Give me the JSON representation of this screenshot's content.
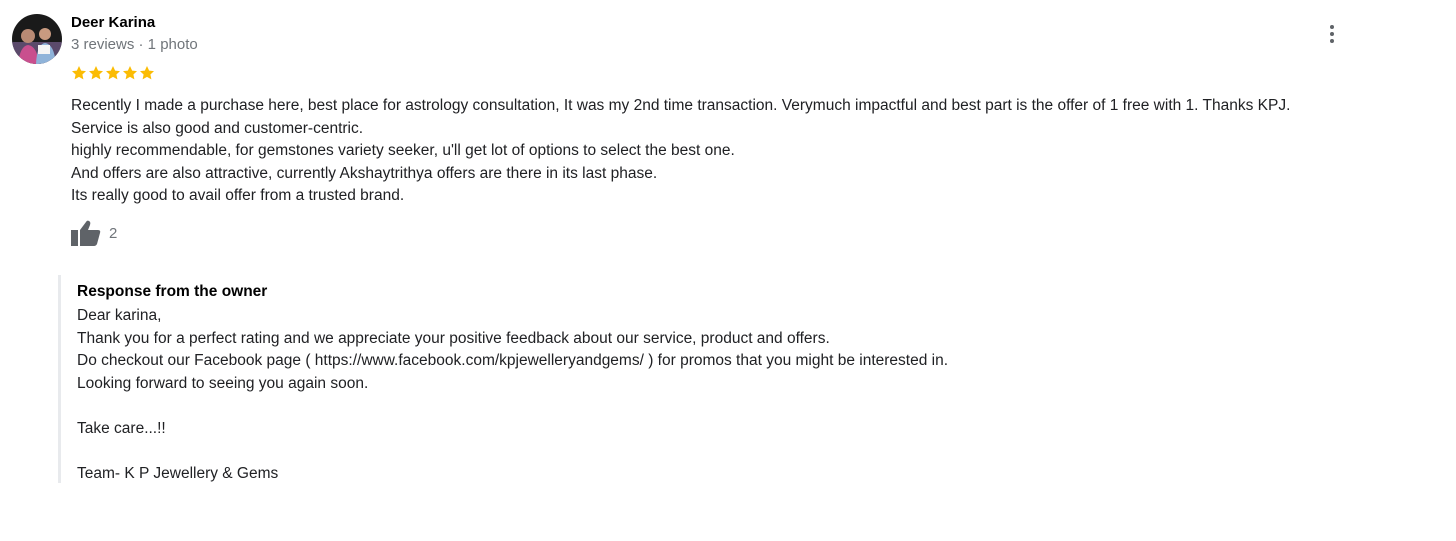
{
  "review": {
    "reviewer_name": "Deer Karina",
    "reviewer_meta": "3 reviews · 1 photo",
    "rating": 5,
    "rating_color": "#fbbc04",
    "text_lines": [
      "Recently I made a purchase here, best place for astrology consultation, It was my 2nd time transaction. Verymuch impactful and best part is the offer of 1 free with 1. Thanks KPJ.",
      "Service is also good and customer-centric.",
      "highly recommendable, for gemstones variety seeker, u'll get lot of options to select the best one.",
      "And offers are also attractive, currently Akshaytrithya offers are there in its last phase.",
      "Its really good to avail offer from a trusted brand."
    ],
    "like_count": "2",
    "icons": {
      "avatar": "avatar-photo",
      "more": "more-vert-icon",
      "star": "star-icon",
      "like": "thumbs-up-icon"
    }
  },
  "owner_response": {
    "title": "Response from the owner",
    "lines": [
      "Dear karina,",
      "Thank you for a perfect rating and we appreciate your positive feedback about our service, product and offers.",
      "Do checkout our Facebook page ( https://www.facebook.com/kpjewelleryandgems/ ) for promos that you might be interested in.",
      "Looking forward to seeing you again soon.",
      "",
      "Take care...!!",
      "",
      "Team- K P Jewellery & Gems"
    ]
  }
}
